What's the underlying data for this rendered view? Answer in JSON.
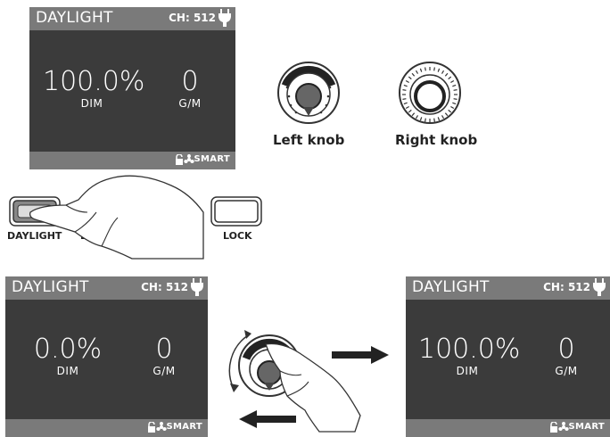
{
  "top_display": {
    "mode": "DAYLIGHT",
    "channel": "CH: 512",
    "dim_value": "100.0%",
    "dim_label": "DIM",
    "gm_value": "0",
    "gm_label": "G/M",
    "footer": "SMART"
  },
  "knobs": {
    "left_caption": "Left knob",
    "right_caption": "Right knob"
  },
  "buttons": {
    "daylight": "DAYLIGHT",
    "partial": "E",
    "lock": "LOCK"
  },
  "bottom_left_display": {
    "mode": "DAYLIGHT",
    "channel": "CH: 512",
    "dim_value": "0.0%",
    "dim_label": "DIM",
    "gm_value": "0",
    "gm_label": "G/M",
    "footer": "SMART"
  },
  "bottom_right_display": {
    "mode": "DAYLIGHT",
    "channel": "CH: 512",
    "dim_value": "100.0%",
    "dim_label": "DIM",
    "gm_value": "0",
    "gm_label": "G/M",
    "footer": "SMART"
  },
  "colors": {
    "screen": "#3b3b3b",
    "bar": "#7a7a7a",
    "arrow": "#222222"
  }
}
